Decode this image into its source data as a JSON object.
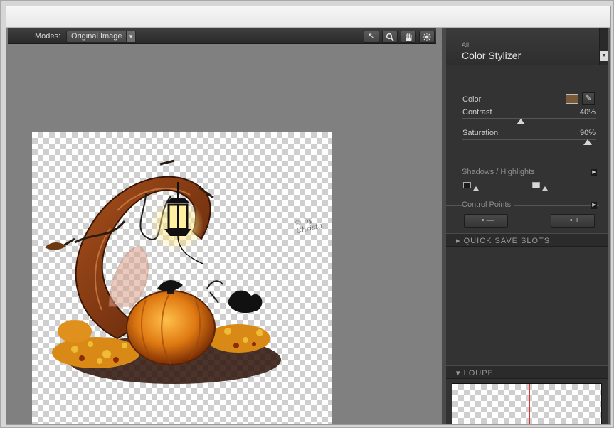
{
  "modes_bar": {
    "label": "Modes:",
    "selected_mode": "Original Image",
    "tools": [
      "pointer-icon",
      "zoom-icon",
      "hand-icon",
      "light-icon"
    ]
  },
  "canvas": {
    "watermark": "© by Christa"
  },
  "panel": {
    "category": "All",
    "title": "Color Stylizer",
    "color": {
      "label": "Color",
      "swatch": "#7a5a36"
    },
    "contrast": {
      "label": "Contrast",
      "value": "40%",
      "level": 0.4
    },
    "saturation": {
      "label": "Saturation",
      "value": "90%",
      "level": 0.9
    },
    "shadows_highlights": {
      "label": "Shadows / Highlights"
    },
    "control_points": {
      "label": "Control Points"
    },
    "quick_save": {
      "label": "QUICK SAVE SLOTS"
    },
    "loupe": {
      "label": "LOUPE"
    }
  }
}
